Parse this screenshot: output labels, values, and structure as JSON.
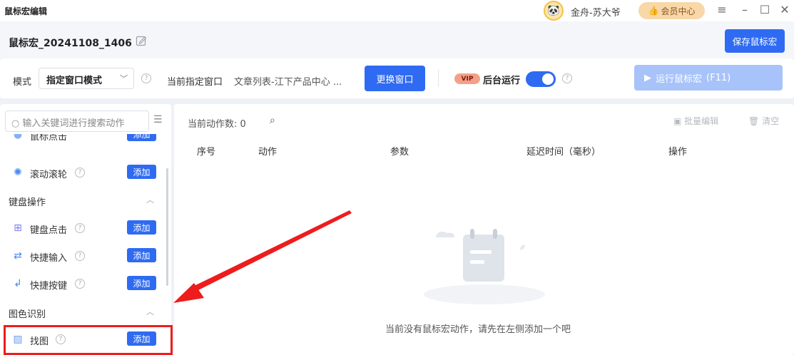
{
  "titlebar": {
    "app_title": "鼠标宏编辑",
    "username": "金舟-苏大爷",
    "vip_center_label": "会员中心",
    "menu_icon": "hamburger-icon",
    "minimize_icon": "minimize-icon",
    "maximize_icon": "maximize-icon",
    "close_icon": "close-icon"
  },
  "header": {
    "macro_name": "鼠标宏_20241108_1406",
    "save_label": "保存鼠标宏"
  },
  "toolbar": {
    "mode_label": "模式",
    "mode_value": "指定窗口模式",
    "current_window_label": "当前指定窗口",
    "current_window_value": "文章列表-江下产品中心 ...",
    "change_window_label": "更换窗口",
    "vip_badge": "VIP",
    "background_run_label": "后台运行",
    "background_run_enabled": true,
    "run_label": "运行鼠标宏",
    "run_shortcut": "(F11)"
  },
  "left_panel": {
    "search_placeholder": "输入关键词进行搜索动作",
    "partial_item": {
      "label": "鼠标点击",
      "add": "添加"
    },
    "items": [
      {
        "label": "滚动滚轮",
        "add": "添加",
        "icon": "scroll-wheel-icon"
      }
    ],
    "categories": [
      {
        "label": "键盘操作",
        "items": [
          {
            "label": "键盘点击",
            "add": "添加",
            "icon": "keyboard-icon"
          },
          {
            "label": "快捷输入",
            "add": "添加",
            "icon": "quick-input-icon"
          },
          {
            "label": "快捷按键",
            "add": "添加",
            "icon": "hotkey-icon"
          }
        ]
      },
      {
        "label": "图色识别",
        "items": [
          {
            "label": "找图",
            "add": "添加",
            "icon": "image-icon"
          }
        ]
      }
    ]
  },
  "main_panel": {
    "count_label": "当前动作数: 0",
    "batch_edit_label": "批量编辑",
    "clear_label": "清空",
    "columns": [
      "序号",
      "动作",
      "参数",
      "延迟时间（毫秒）",
      "操作"
    ],
    "empty_text": "当前没有鼠标宏动作，请先在左侧添加一个吧"
  },
  "colors": {
    "primary": "#2f6bf2",
    "primary_disabled": "#a8c3fa",
    "highlight_red": "#ee1c1c"
  }
}
